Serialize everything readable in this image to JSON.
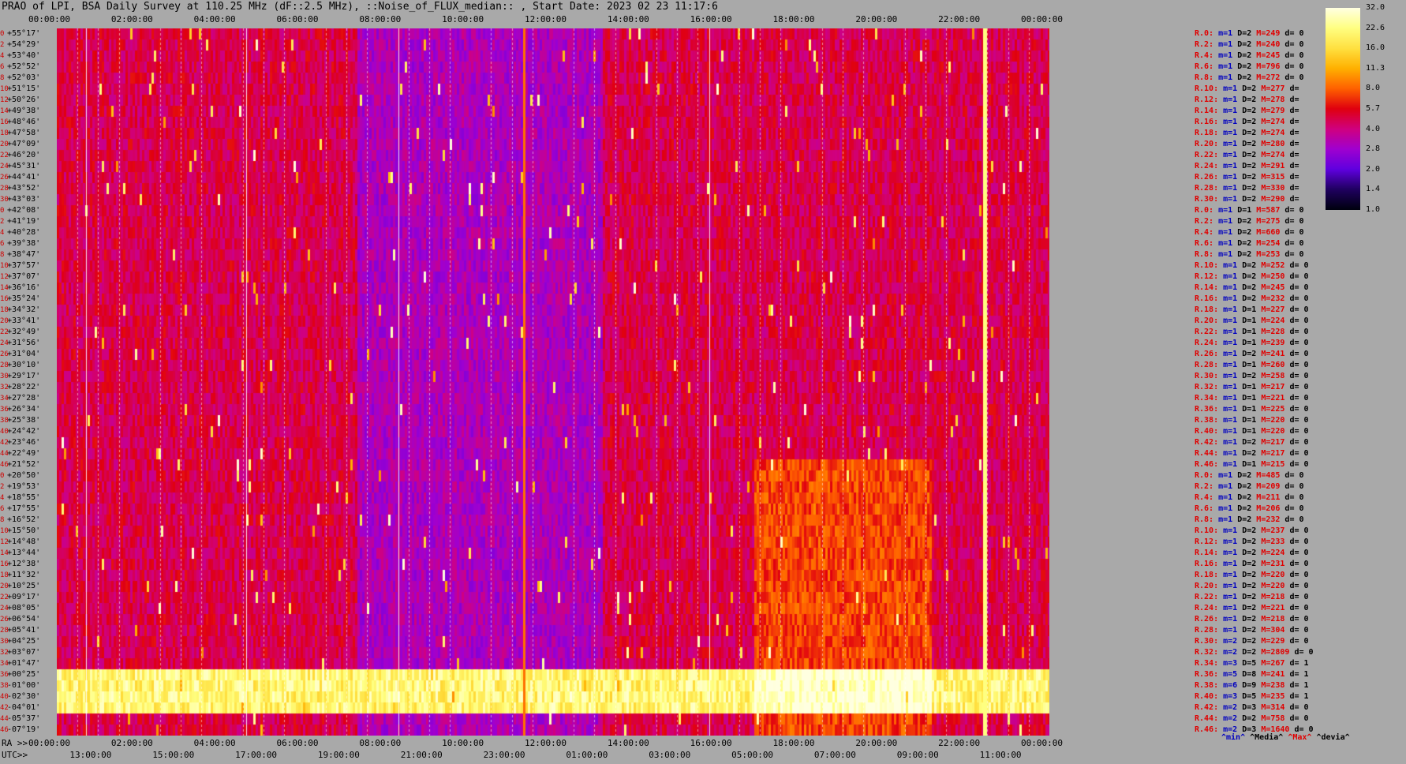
{
  "title": "PRAO of LPI, BSA Daily Survey at 110.25 MHz (dF::2.5 MHz), ::Noise_of_FLUX_median:: , Start Date: 2023 02 23 11:17:6",
  "chart_data": {
    "type": "heatmap",
    "title": "PRAO of LPI, BSA Daily Survey at 110.25 MHz (dF::2.5 MHz), ::Noise_of_FLUX_median:: , Start Date: 2023 02 23 11:17:6",
    "x_top_ticks": [
      "00:00:00",
      "02:00:00",
      "04:00:00",
      "06:00:00",
      "08:00:00",
      "10:00:00",
      "12:00:00",
      "14:00:00",
      "16:00:00",
      "18:00:00",
      "20:00:00",
      "22:00:00",
      "00:00:00"
    ],
    "x_bottom_ra_ticks": [
      "00:00:00",
      "02:00:00",
      "04:00:00",
      "06:00:00",
      "08:00:00",
      "10:00:00",
      "12:00:00",
      "14:00:00",
      "16:00:00",
      "18:00:00",
      "20:00:00",
      "22:00:00",
      "00:00:00"
    ],
    "x_bottom_utc_ticks": [
      "13:00:00",
      "15:00:00",
      "17:00:00",
      "19:00:00",
      "21:00:00",
      "23:00:00",
      "01:00:00",
      "03:00:00",
      "05:00:00",
      "07:00:00",
      "09:00:00",
      "11:00:00"
    ],
    "y_dec_labels": [
      "+55°17'",
      "+54°29'",
      "+53°40'",
      "+52°52'",
      "+52°03'",
      "+51°15'",
      "+50°26'",
      "+49°38'",
      "+48°46'",
      "+47°58'",
      "+47°09'",
      "+46°20'",
      "+45°31'",
      "+44°41'",
      "+43°52'",
      "+43°03'",
      "+42°08'",
      "+41°19'",
      "+40°28'",
      "+39°38'",
      "+38°47'",
      "+37°57'",
      "+37°07'",
      "+36°16'",
      "+35°24'",
      "+34°32'",
      "+33°41'",
      "+32°49'",
      "+31°56'",
      "+31°04'",
      "+30°10'",
      "+29°17'",
      "+28°22'",
      "+27°28'",
      "+26°34'",
      "+25°38'",
      "+24°42'",
      "+23°46'",
      "+22°49'",
      "+21°52'",
      "+20°50'",
      "+19°53'",
      "+18°55'",
      "+17°55'",
      "+16°52'",
      "+15°50'",
      "+14°48'",
      "+13°44'",
      "+12°38'",
      "+11°32'",
      "+10°25'",
      "+09°17'",
      "+08°05'",
      "+06°54'",
      "+05°41'",
      "+04°25'",
      "+03°07'",
      "+01°47'",
      "+00°25'",
      "-01°00'",
      "-02°30'",
      "-04°01'",
      "-05°37'",
      "-07°19'"
    ],
    "row_index": [
      "0",
      "2",
      "4",
      "6",
      "8",
      "10",
      "12",
      "14",
      "16",
      "18",
      "20",
      "22",
      "24",
      "26",
      "28",
      "30",
      "0",
      "2",
      "4",
      "6",
      "8",
      "10",
      "12",
      "14",
      "16",
      "18",
      "20",
      "22",
      "24",
      "26",
      "28",
      "30",
      "32",
      "34",
      "36",
      "38",
      "40",
      "42",
      "44",
      "46",
      "0",
      "2",
      "4",
      "6",
      "8",
      "10",
      "12",
      "14",
      "16",
      "18",
      "20",
      "22",
      "24",
      "26",
      "28",
      "30",
      "32",
      "34",
      "36",
      "38",
      "40",
      "42",
      "44",
      "46"
    ],
    "colorbar": {
      "ticks": [
        "32.0",
        "22.6",
        "16.0",
        "11.3",
        "8.0",
        "5.7",
        "4.0",
        "2.8",
        "2.0",
        "1.4",
        "1.0"
      ],
      "colors": [
        "#ffffe0",
        "#ffff80",
        "#ffe040",
        "#ffb000",
        "#ff6000",
        "#e00010",
        "#d00080",
        "#a000d0",
        "#6000e0",
        "#200060",
        "#000010"
      ]
    },
    "right_rows": [
      [
        "R.0:",
        "m=1",
        "D=2",
        "M=249",
        "d= 0"
      ],
      [
        "R.2:",
        "m=1",
        "D=2",
        "M=240",
        "d= 0"
      ],
      [
        "R.4:",
        "m=1",
        "D=2",
        "M=245",
        "d= 0"
      ],
      [
        "R.6:",
        "m=1",
        "D=2",
        "M=796",
        "d= 0"
      ],
      [
        "R.8:",
        "m=1",
        "D=2",
        "M=272",
        "d= 0"
      ],
      [
        "R.10:",
        "m=1",
        "D=2",
        "M=277",
        "d="
      ],
      [
        "R.12:",
        "m=1",
        "D=2",
        "M=278",
        "d="
      ],
      [
        "R.14:",
        "m=1",
        "D=2",
        "M=279",
        "d="
      ],
      [
        "R.16:",
        "m=1",
        "D=2",
        "M=274",
        "d="
      ],
      [
        "R.18:",
        "m=1",
        "D=2",
        "M=274",
        "d="
      ],
      [
        "R.20:",
        "m=1",
        "D=2",
        "M=280",
        "d="
      ],
      [
        "R.22:",
        "m=1",
        "D=2",
        "M=274",
        "d="
      ],
      [
        "R.24:",
        "m=1",
        "D=2",
        "M=291",
        "d="
      ],
      [
        "R.26:",
        "m=1",
        "D=2",
        "M=315",
        "d="
      ],
      [
        "R.28:",
        "m=1",
        "D=2",
        "M=330",
        "d="
      ],
      [
        "R.30:",
        "m=1",
        "D=2",
        "M=290",
        "d="
      ],
      [
        "R.0:",
        "m=1",
        "D=1",
        "M=587",
        "d= 0"
      ],
      [
        "R.2:",
        "m=1",
        "D=2",
        "M=275",
        "d= 0"
      ],
      [
        "R.4:",
        "m=1",
        "D=2",
        "M=660",
        "d= 0"
      ],
      [
        "R.6:",
        "m=1",
        "D=2",
        "M=254",
        "d= 0"
      ],
      [
        "R.8:",
        "m=1",
        "D=2",
        "M=253",
        "d= 0"
      ],
      [
        "R.10:",
        "m=1",
        "D=2",
        "M=252",
        "d= 0"
      ],
      [
        "R.12:",
        "m=1",
        "D=2",
        "M=250",
        "d= 0"
      ],
      [
        "R.14:",
        "m=1",
        "D=2",
        "M=245",
        "d= 0"
      ],
      [
        "R.16:",
        "m=1",
        "D=2",
        "M=232",
        "d= 0"
      ],
      [
        "R.18:",
        "m=1",
        "D=1",
        "M=227",
        "d= 0"
      ],
      [
        "R.20:",
        "m=1",
        "D=1",
        "M=224",
        "d= 0"
      ],
      [
        "R.22:",
        "m=1",
        "D=1",
        "M=228",
        "d= 0"
      ],
      [
        "R.24:",
        "m=1",
        "D=1",
        "M=239",
        "d= 0"
      ],
      [
        "R.26:",
        "m=1",
        "D=2",
        "M=241",
        "d= 0"
      ],
      [
        "R.28:",
        "m=1",
        "D=1",
        "M=260",
        "d= 0"
      ],
      [
        "R.30:",
        "m=1",
        "D=2",
        "M=258",
        "d= 0"
      ],
      [
        "R.32:",
        "m=1",
        "D=1",
        "M=217",
        "d= 0"
      ],
      [
        "R.34:",
        "m=1",
        "D=1",
        "M=221",
        "d= 0"
      ],
      [
        "R.36:",
        "m=1",
        "D=1",
        "M=225",
        "d= 0"
      ],
      [
        "R.38:",
        "m=1",
        "D=1",
        "M=220",
        "d= 0"
      ],
      [
        "R.40:",
        "m=1",
        "D=1",
        "M=220",
        "d= 0"
      ],
      [
        "R.42:",
        "m=1",
        "D=2",
        "M=217",
        "d= 0"
      ],
      [
        "R.44:",
        "m=1",
        "D=2",
        "M=217",
        "d= 0"
      ],
      [
        "R.46:",
        "m=1",
        "D=1",
        "M=215",
        "d= 0"
      ],
      [
        "R.0:",
        "m=1",
        "D=2",
        "M=485",
        "d= 0"
      ],
      [
        "R.2:",
        "m=1",
        "D=2",
        "M=209",
        "d= 0"
      ],
      [
        "R.4:",
        "m=1",
        "D=2",
        "M=211",
        "d= 0"
      ],
      [
        "R.6:",
        "m=1",
        "D=2",
        "M=206",
        "d= 0"
      ],
      [
        "R.8:",
        "m=1",
        "D=2",
        "M=232",
        "d= 0"
      ],
      [
        "R.10:",
        "m=1",
        "D=2",
        "M=237",
        "d= 0"
      ],
      [
        "R.12:",
        "m=1",
        "D=2",
        "M=233",
        "d= 0"
      ],
      [
        "R.14:",
        "m=1",
        "D=2",
        "M=224",
        "d= 0"
      ],
      [
        "R.16:",
        "m=1",
        "D=2",
        "M=231",
        "d= 0"
      ],
      [
        "R.18:",
        "m=1",
        "D=2",
        "M=220",
        "d= 0"
      ],
      [
        "R.20:",
        "m=1",
        "D=2",
        "M=220",
        "d= 0"
      ],
      [
        "R.22:",
        "m=1",
        "D=2",
        "M=218",
        "d= 0"
      ],
      [
        "R.24:",
        "m=1",
        "D=2",
        "M=221",
        "d= 0"
      ],
      [
        "R.26:",
        "m=1",
        "D=2",
        "M=218",
        "d= 0"
      ],
      [
        "R.28:",
        "m=1",
        "D=2",
        "M=304",
        "d= 0"
      ],
      [
        "R.30:",
        "m=2",
        "D=2",
        "M=229",
        "d= 0"
      ],
      [
        "R.32:",
        "m=2",
        "D=2",
        "M=2809",
        "d= 0"
      ],
      [
        "R.34:",
        "m=3",
        "D=5",
        "M=267",
        "d= 1"
      ],
      [
        "R.36:",
        "m=5",
        "D=8",
        "M=241",
        "d= 1"
      ],
      [
        "R.38:",
        "m=6",
        "D=9",
        "M=238",
        "d= 1"
      ],
      [
        "R.40:",
        "m=3",
        "D=5",
        "M=235",
        "d= 1"
      ],
      [
        "R.42:",
        "m=2",
        "D=3",
        "M=314",
        "d= 0"
      ],
      [
        "R.44:",
        "m=2",
        "D=2",
        "M=758",
        "d= 0"
      ],
      [
        "R.46:",
        "m=2",
        "D=3",
        "M=1640",
        "d= 0"
      ]
    ],
    "legend": {
      "min": "^min^",
      "median": "^Media^",
      "max": "^Max^",
      "dev": "^devia^"
    },
    "ra_prefix": "RA >>",
    "utc_prefix": "UTC>>"
  }
}
